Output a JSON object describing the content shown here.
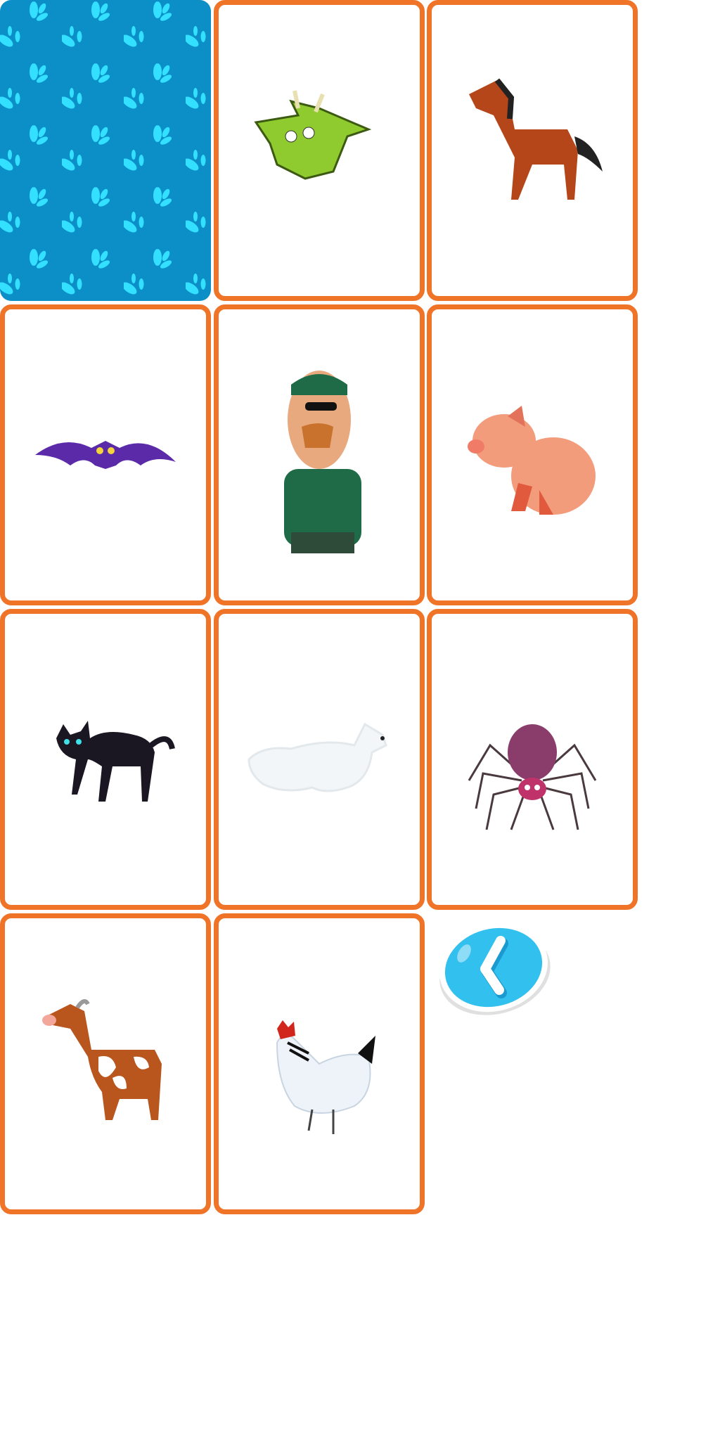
{
  "colors": {
    "card_border": "#F07428",
    "card_back": "#0B8FC6",
    "leaf": "#33E0FF",
    "back_button": "#32C1EE"
  },
  "cards": [
    {
      "state": "face-down",
      "icon": "leaf-pattern"
    },
    {
      "state": "face-up",
      "icon": "dragon"
    },
    {
      "state": "face-up",
      "icon": "horse"
    },
    {
      "state": "face-up",
      "icon": "bat"
    },
    {
      "state": "face-up",
      "icon": "man-with-bandana"
    },
    {
      "state": "face-up",
      "icon": "pig"
    },
    {
      "state": "face-up",
      "icon": "black-cat"
    },
    {
      "state": "face-up",
      "icon": "ghost-dog"
    },
    {
      "state": "face-up",
      "icon": "spider"
    },
    {
      "state": "face-up",
      "icon": "cow"
    },
    {
      "state": "face-up",
      "icon": "hen"
    }
  ],
  "back_button": {
    "icon": "chevron-left"
  }
}
